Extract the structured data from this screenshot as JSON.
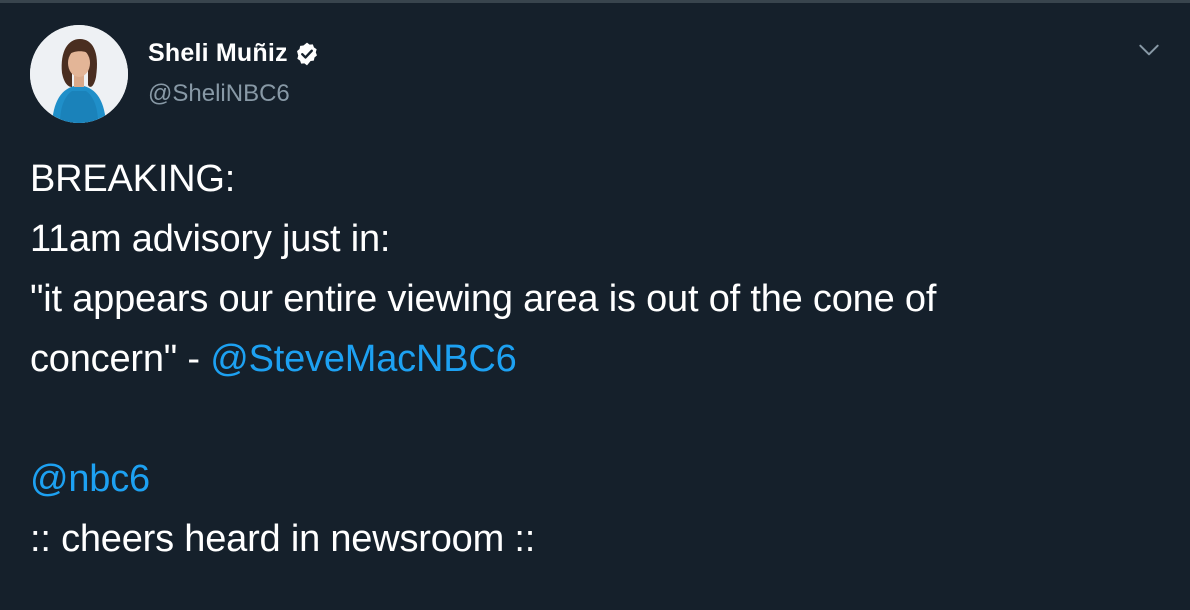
{
  "author": {
    "display_name": "Sheli Muñiz",
    "handle": "@SheliNBC6",
    "verified": true
  },
  "icons": {
    "verified": "verified-badge-icon",
    "menu": "chevron-down-icon"
  },
  "colors": {
    "background": "#15202b",
    "text": "#ffffff",
    "secondary_text": "#8899a6",
    "link": "#1da1f2"
  },
  "tweet": {
    "line1": "BREAKING:",
    "line2": "11am advisory just in:",
    "line3": "\"it appears our entire viewing area is out of the cone of",
    "line4_prefix": "concern\" - ",
    "line4_mention": "@SteveMacNBC6",
    "line5_mention": "@nbc6",
    "line6": ":: cheers heard in newsroom ::"
  }
}
